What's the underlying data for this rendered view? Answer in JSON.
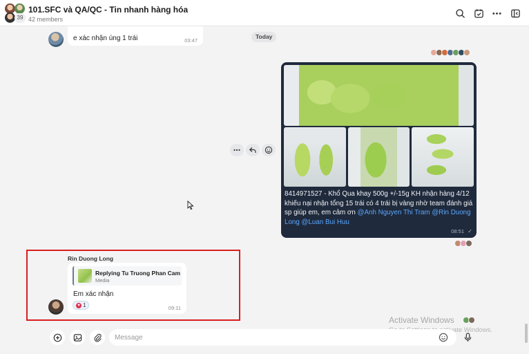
{
  "header": {
    "title": "101.SFC và QA/QC - Tin nhanh hàng hóa",
    "members": "42 members",
    "avatar_count": "39"
  },
  "previous_message": {
    "text": "e xác nhận úng 1 trái",
    "time": "03:47"
  },
  "day_separator": "Today",
  "media_message": {
    "caption_prefix": "8414971527 - Khổ Qua khay 500g +/-15g KH nhận hàng 4/12 khiếu nại nhận tổng 15 trái có 4 trái bị vàng nhờ team đánh giá sp giúp em, em cảm ơn ",
    "mentions": [
      "@Anh Nguyen Thi Tram",
      "@Rin Duong Long",
      "@Luan Bui Huu"
    ],
    "time": "08:51"
  },
  "reply_message": {
    "sender": "Rin Duong Long",
    "quote_title": "Replying Tu Truong Phan Cam",
    "quote_subtitle": "Media",
    "text": "Em xác nhận",
    "reaction_count": "1",
    "time": "09:11"
  },
  "composer": {
    "placeholder": "Message"
  },
  "watermark": {
    "title": "Activate Windows",
    "subtitle": "Go to Settings to activate Windows."
  },
  "colors": {
    "accent": "#5aa8ff",
    "media_bubble": "#1f2a3c",
    "highlight": "#d91e1e",
    "reaction_heart": "#e0314f"
  }
}
